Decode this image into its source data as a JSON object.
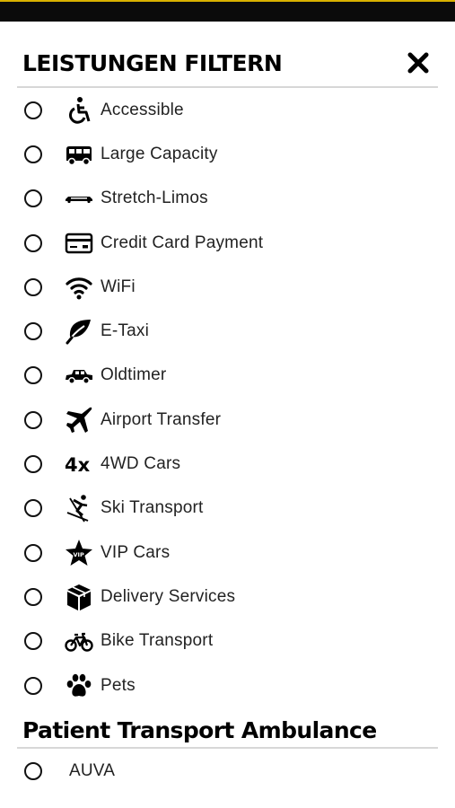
{
  "header": {
    "title": "LEISTUNGEN FILTERN",
    "close_icon": "close-icon"
  },
  "filters": [
    {
      "label": "Accessible",
      "icon": "wheelchair-icon"
    },
    {
      "label": "Large Capacity",
      "icon": "van-icon"
    },
    {
      "label": "Stretch-Limos",
      "icon": "limo-icon"
    },
    {
      "label": "Credit Card Payment",
      "icon": "credit-card-icon"
    },
    {
      "label": "WiFi",
      "icon": "wifi-icon"
    },
    {
      "label": "E-Taxi",
      "icon": "leaf-icon"
    },
    {
      "label": "Oldtimer",
      "icon": "vintage-car-icon"
    },
    {
      "label": "Airport Transfer",
      "icon": "plane-icon"
    },
    {
      "label": "4WD Cars",
      "icon": "4x-icon"
    },
    {
      "label": "Ski Transport",
      "icon": "skier-icon"
    },
    {
      "label": "VIP Cars",
      "icon": "vip-star-icon"
    },
    {
      "label": "Delivery Services",
      "icon": "package-icon"
    },
    {
      "label": "Bike Transport",
      "icon": "bicycle-icon"
    },
    {
      "label": "Pets",
      "icon": "paw-icon"
    }
  ],
  "section": {
    "title": "Patient Transport Ambulance"
  },
  "section_items": [
    {
      "label": "AUVA"
    }
  ],
  "colors": {
    "topbar": "#0b0b0b",
    "accent_line": "#d8b000",
    "text": "#111111"
  }
}
